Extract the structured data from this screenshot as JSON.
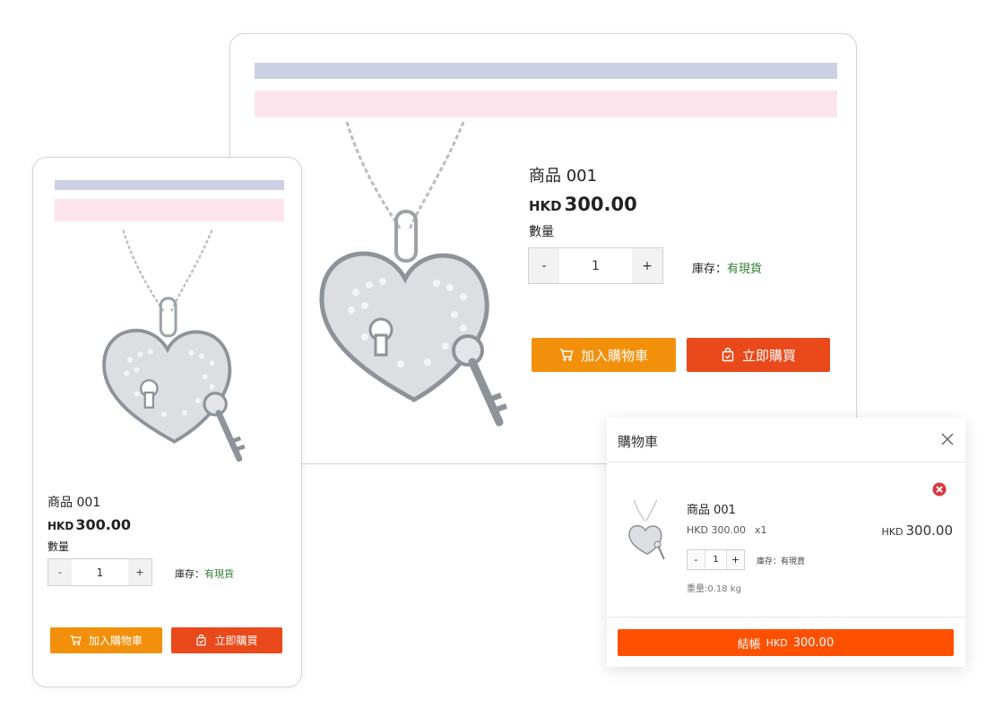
{
  "product": {
    "title": "商品 001",
    "currency": "HKD",
    "price": "300.00",
    "qty_label": "數量",
    "qty_minus": "-",
    "qty_plus": "+",
    "qty_value": "1",
    "stock_label": "庫存：",
    "stock_value": "有現貨",
    "add_to_cart": "加入購物車",
    "buy_now": "立即購買"
  },
  "cart": {
    "title": "購物車",
    "item": {
      "name": "商品 001",
      "unit_price": "HKD 300.00",
      "qty_text": "x1",
      "total_currency": "HKD",
      "total_amount": "300.00",
      "qty_minus": "-",
      "qty_value": "1",
      "qty_plus": "+",
      "stock": "庫存：有現貨",
      "weight": "重量:0.18 kg"
    },
    "checkout_label": "結帳",
    "checkout_currency": "HKD",
    "checkout_amount": "300.00"
  },
  "icons": {
    "cart": "shopping-cart-icon",
    "bag": "shopping-bag-icon",
    "close": "close-icon",
    "remove": "remove-circle-icon"
  },
  "colors": {
    "orange_button": "#f3900b",
    "red_button": "#e9491b",
    "checkout_button": "#ff5000",
    "stock_green": "#2f7d32",
    "header_bar": "#cdd0e2",
    "banner_bar": "#fde3ec",
    "remove_red": "#d9363e"
  }
}
